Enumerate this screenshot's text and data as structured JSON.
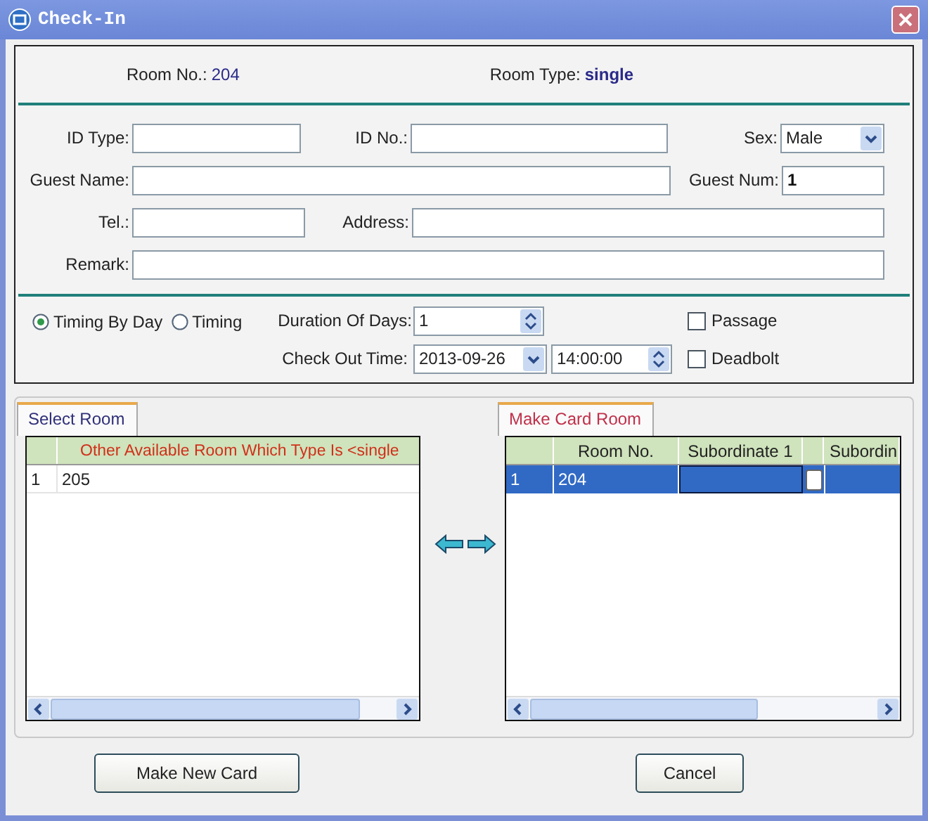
{
  "window": {
    "title": "Check-In"
  },
  "room": {
    "room_no_label": "Room No.:",
    "room_no": "204",
    "room_type_label": "Room Type:",
    "room_type": "single"
  },
  "form_rows": [
    [
      {
        "label": "ID Type:",
        "kind": "text"
      },
      {
        "label": "ID No.:",
        "kind": "text"
      },
      {
        "label": "Sex:",
        "kind": "select",
        "value": "Male"
      }
    ],
    [
      {
        "label": "Guest Name:",
        "kind": "text"
      },
      {
        "label": "Guest Num:",
        "kind": "text",
        "value": "1"
      }
    ],
    [
      {
        "label": "Tel.:",
        "kind": "text"
      },
      {
        "label": "Address:",
        "kind": "text"
      }
    ],
    [
      {
        "label": "Remark:",
        "kind": "text"
      }
    ]
  ],
  "timing_modes": [
    {
      "label": "Timing By Day",
      "selected": true
    },
    {
      "label": "Timing",
      "selected": false
    }
  ],
  "duration": {
    "label": "Duration Of Days:",
    "value": "1"
  },
  "check_out": {
    "label": "Check Out Time:",
    "date": "2013-09-26",
    "time": "14:00:00"
  },
  "options": [
    {
      "label": "Passage",
      "checked": false
    },
    {
      "label": "Deadbolt",
      "checked": false
    }
  ],
  "select_room": {
    "tab": "Select Room",
    "column": "Other Available Room Which Type Is <single",
    "rows": [
      {
        "number": "1",
        "room": "205",
        "selected": false
      }
    ]
  },
  "make_card_room": {
    "tab": "Make Card Room",
    "columns": [
      "Room No.",
      "Subordinate 1",
      "Subordin"
    ],
    "rows": [
      {
        "number": "1",
        "room": "204",
        "selected": true
      }
    ]
  },
  "buttons": [
    {
      "label": "Make New Card"
    },
    {
      "label": "Cancel"
    }
  ]
}
